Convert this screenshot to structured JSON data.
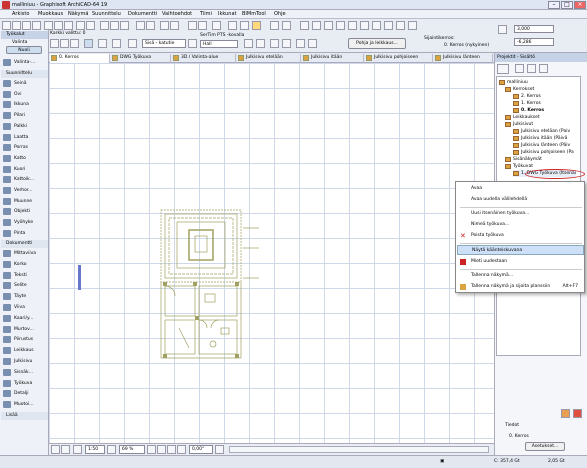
{
  "titlebar": {
    "title": "malliniuu - Graphisoft ArchiCAD-64 19"
  },
  "menu": [
    "Arkisto",
    "Muokkaus",
    "Näkymä",
    "Suunnittelu",
    "Dokumentti",
    "Vaihtoehdot",
    "Tiimi",
    "Ikkunat",
    "BIMmTool",
    "Ohje"
  ],
  "toolbar": {
    "info_label": "Karkki valittu: 0",
    "layer_select": "Sisä - katutie",
    "pen_label": "SerTim PTS -kovalla",
    "pen_value": "Hall",
    "view_button": "Pohja ja leikkaus...",
    "floor_label": "Sijaintikerros:",
    "floor_value": "0. Kerros (nykyinen)",
    "dim_a": "3,000",
    "dim_b": "-6,286"
  },
  "leftpanel": {
    "header": "Työkalut",
    "select": "Valinta",
    "arrow": "Nuoli",
    "valinta": "Valinta-...",
    "sections": [
      "Suunnittelu",
      "Dokumentti",
      "Lisää"
    ],
    "design_tools": [
      "Seinä",
      "Ovi",
      "Ikkuna",
      "Pilari",
      "Palkki",
      "Laatta",
      "Porras",
      "Katto",
      "Kuori",
      "Kattoik...",
      "Verhor...",
      "Muunne",
      "Objekti",
      "Vyöhyke",
      "Pinta"
    ],
    "doc_tools": [
      "Mittaviiva",
      "Korko",
      "Teksti",
      "Selite",
      "Täyte",
      "Viiva",
      "Kaari/y...",
      "Murtov...",
      "Piirustus",
      "Leikkaus",
      "Julkisivu",
      "Sisnäk...",
      "Työkuva",
      "Detalji",
      "Muotoi..."
    ]
  },
  "tabs": [
    "0. Kerros",
    "DWG Työkuva",
    "3D / Valinta-alue",
    "Julkisivu etelään",
    "Julkisivu itään",
    "Julkisivu pohjoiseen",
    "Julkisivu länteen"
  ],
  "navigator": {
    "header": "Projektit - Sisältö",
    "root": "malliniuu",
    "kerrokset": "Kerrokset",
    "floors": [
      "2. Kerros",
      "1. Kerros",
      "0. Kerros"
    ],
    "leikkaukset": "Leikkaukset",
    "julkisivut": "Julkisivut",
    "elevations": [
      "Julkisivu eteläan (Paiv",
      "Julkisivu itään (Päivä",
      "Julkisivu länteen (Päiv",
      "Julkisivu pohjoiseen (Pa"
    ],
    "sisanakymat": "Sisänäkymät",
    "tyokuvat": "Työkuvat",
    "selected": "1. DWG Työkuva (Itsenäi",
    "tiedot": "Tiedot",
    "info_value": "0. Kerros",
    "info_button": "Asetukset..."
  },
  "context_menu": {
    "items": [
      {
        "label": "Avaa",
        "shortcut": ""
      },
      {
        "label": "Avaa uudella välilehdellä",
        "shortcut": ""
      },
      {
        "label": "Uusi itsenäinen työkuva...",
        "shortcut": ""
      },
      {
        "label": "Nimeä työkuva...",
        "shortcut": ""
      },
      {
        "label": "Poista työkuva",
        "shortcut": ""
      },
      {
        "label": "Näytä käänteiskuvana",
        "shortcut": ""
      },
      {
        "label": "Mieti uudestaan",
        "shortcut": ""
      },
      {
        "label": "Tallenna näkymä...",
        "shortcut": ""
      },
      {
        "label": "Tallenna näkymä ja sijoita planssiin",
        "shortcut": "Alt+F7"
      }
    ]
  },
  "status": {
    "scale": "1:50",
    "zoom": "69 %",
    "angle": "0,00°",
    "disk": "C: 357,4 Gt",
    "mem": "2,05 Gt"
  },
  "colors": {
    "accent": "#3a6fb0",
    "highlight": "#cde0f7",
    "plan_line": "#a0a060"
  }
}
